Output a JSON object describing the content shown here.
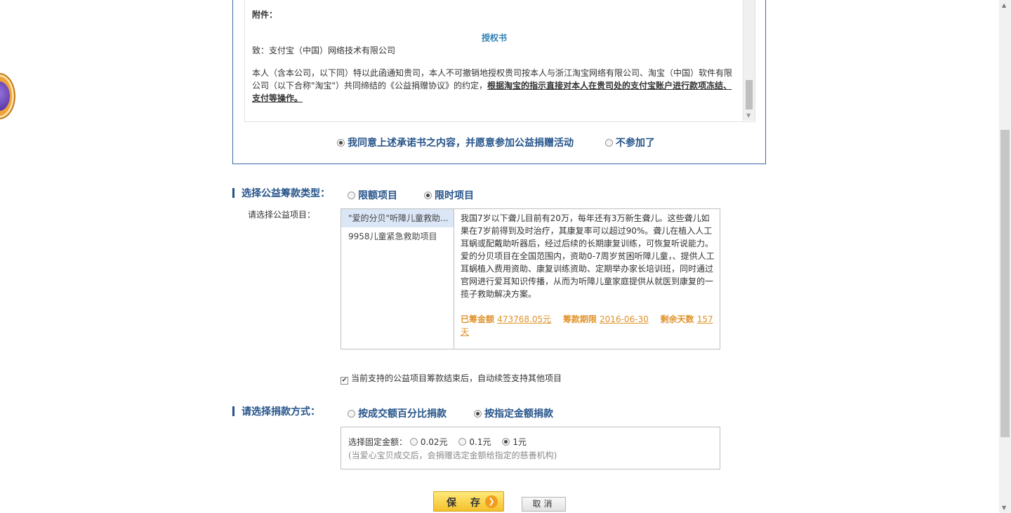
{
  "agreement": {
    "attachment_label": "附件：",
    "title": "授权书",
    "to_line": "致：支付宝（中国）网络技术有限公司",
    "body_normal": "本人（含本公司，以下同）特以此函通知贵司，本人不可撤销地授权贵司按本人与浙江淘宝网络有限公司、淘宝（中国）软件有限公司（以下合称\"淘宝\"）共同缔结的《公益捐赠协议》的约定，",
    "body_underline": "根据淘宝的指示直接对本人在贵司处的支付宝账户进行款项冻结、支付等操作。",
    "option_agree": "我同意上述承诺书之内容，并愿意参加公益捐赠活动",
    "option_decline": "不参加了"
  },
  "fund_type": {
    "label": "选择公益筹款类型：",
    "option_limited_amount": "限额项目",
    "option_limited_time": "限时项目",
    "selected": "限时项目"
  },
  "project": {
    "label": "请选择公益项目：",
    "items": [
      "\"爱的分贝\"听障儿童救助...",
      "9958儿童紧急救助项目"
    ],
    "description": "我国7岁以下聋儿目前有20万，每年还有3万新生聋儿。这些聋儿如果在7岁前得到及时治疗，其康复率可以超过90%。聋儿在植入人工耳蜗或配戴助听器后，经过后续的长期康复训练，可恢复听说能力。爱的分贝项目在全国范围内，资助0-7周岁贫困听障儿童，、提供人工耳蜗植入费用资助、康复训练资助、定期举办家长培训班，同时通过官网进行爱耳知识传播，从而为听障儿童家庭提供从就医到康复的一揽子救助解决方案。",
    "raised_label": "已筹金额",
    "raised_value": "473768.05元",
    "deadline_label": "筹款期限",
    "deadline_value": "2016-06-30",
    "days_label": "剩余天数",
    "days_value": "157天"
  },
  "auto_renew": {
    "checked": true,
    "label": "当前支持的公益项目筹款结束后，自动续签支持其他项目"
  },
  "donation_method": {
    "label": "请选择捐款方式：",
    "option_percent": "按成交额百分比捐款",
    "option_fixed": "按指定金额捐款",
    "selected": "按指定金额捐款",
    "fixed_label": "选择固定金额：",
    "amounts": [
      "0.02元",
      "0.1元",
      "1元"
    ],
    "selected_amount": "1元",
    "note": "(当爱心宝贝成交后，会捐赠选定金额给指定的慈善机构)"
  },
  "buttons": {
    "save": "保存",
    "cancel": "取消"
  }
}
